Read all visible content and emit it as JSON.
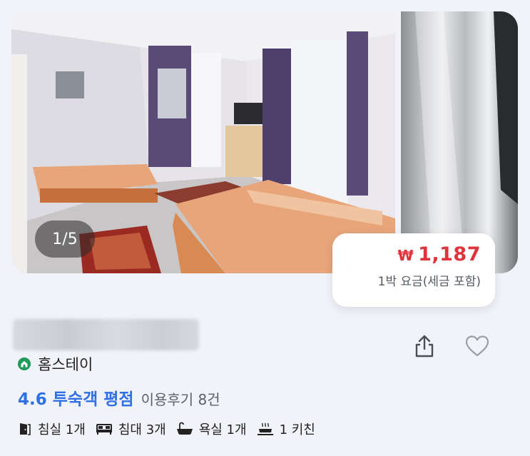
{
  "gallery": {
    "counter": "1/5"
  },
  "price_card": {
    "currency": "₩",
    "amount": "1,187",
    "note": "1박 요금(세금 포함)"
  },
  "listing": {
    "type_label": "홈스테이",
    "rating_text": "4.6 투숙객 평점",
    "review_text": "이용후기 8건"
  },
  "amenities": [
    {
      "icon": "door-icon",
      "label": "침실 1개"
    },
    {
      "icon": "bed-icon",
      "label": "침대 3개"
    },
    {
      "icon": "bathtub-icon",
      "label": "욕실 1개"
    },
    {
      "icon": "kitchen-icon",
      "label": "1 키친"
    }
  ],
  "colors": {
    "price": "#e0343d",
    "rating": "#2f70e6",
    "homestay_icon": "#1f9a5a",
    "background": "#f1f3f9"
  }
}
